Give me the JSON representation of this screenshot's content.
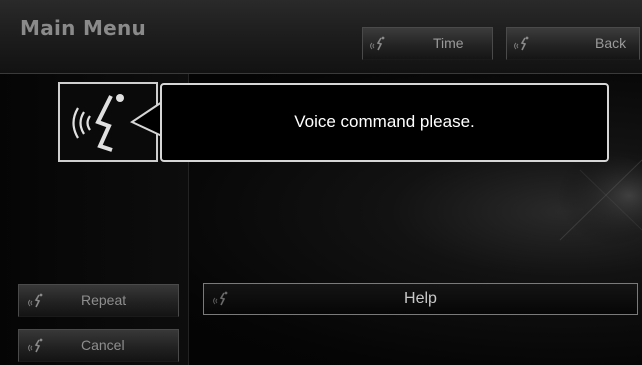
{
  "header": {
    "title": "Main Menu",
    "time_button": {
      "label": "Time",
      "icon": "voice-command-icon"
    },
    "back_button": {
      "label": "Back",
      "icon": "voice-command-icon"
    }
  },
  "prompt": {
    "icon": "speaking-head-icon",
    "message": "Voice command please."
  },
  "sidebar": {
    "repeat_button": {
      "label": "Repeat",
      "icon": "voice-command-icon"
    },
    "cancel_button": {
      "label": "Cancel",
      "icon": "voice-command-icon"
    }
  },
  "main": {
    "help_button": {
      "label": "Help",
      "icon": "voice-command-icon"
    }
  },
  "colors": {
    "background": "#000000",
    "bubble_border": "#d6d6d6",
    "title": "#8a8a8a",
    "button_text": "#9a9a9a"
  }
}
